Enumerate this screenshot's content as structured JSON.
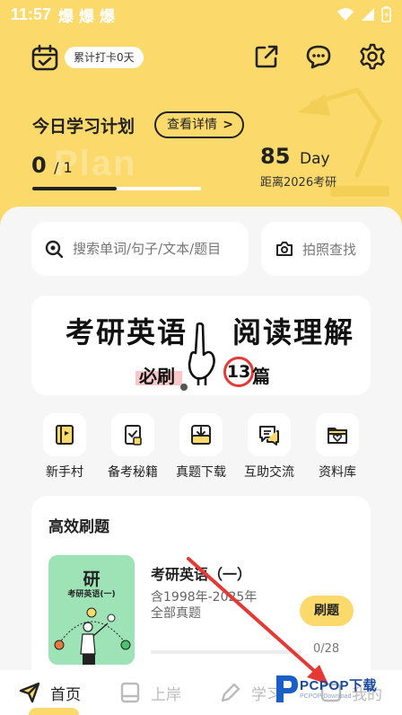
{
  "status": {
    "time": "11:57",
    "notifications": [
      "爆",
      "爆",
      "爆"
    ]
  },
  "header": {
    "streak_label": "累计打卡0天"
  },
  "plan": {
    "watermark": "Plan",
    "title": "今日学习计划",
    "detail_button": "查看详情",
    "done": "0",
    "total": "/ 1",
    "progress_fraction": 0.5,
    "countdown_value": "85",
    "countdown_unit": "Day",
    "countdown_label": "距离2026考研"
  },
  "search": {
    "placeholder": "搜索单词/句子/文本/题目"
  },
  "photo_search": {
    "label": "拍照查找"
  },
  "banner": {
    "line1_left": "考研英语",
    "line1_right": "阅读理解",
    "line2_left": "必刷",
    "line2_num": "13",
    "line2_right": "篇"
  },
  "shortcuts": [
    {
      "label": "新手村",
      "icon": "novice-book-icon"
    },
    {
      "label": "备考秘籍",
      "icon": "checklist-icon"
    },
    {
      "label": "真题下载",
      "icon": "download-tray-icon"
    },
    {
      "label": "互助交流",
      "icon": "chat-bubbles-icon"
    },
    {
      "label": "资料库",
      "icon": "folder-heart-icon"
    }
  ],
  "practice": {
    "title": "高效刷题",
    "book_title": "研",
    "book_subtitle": "考研英语(一)",
    "item_title": "考研英语（一）",
    "item_desc1": "含1998年-2025年",
    "item_desc2": "全部真题",
    "button": "刷题",
    "count": "0/28",
    "progress_fraction": 0
  },
  "nav": [
    {
      "label": "首页",
      "active": true
    },
    {
      "label": "上岸",
      "active": false
    },
    {
      "label": "学习",
      "active": false
    },
    {
      "label": "我的",
      "active": false
    }
  ],
  "watermark_brand": {
    "text": "PCPOP下载",
    "sub": "PCPOP Download"
  },
  "colors": {
    "accent": "#fbd96a",
    "book": "#9ee3b6",
    "arrow": "#e53935"
  }
}
